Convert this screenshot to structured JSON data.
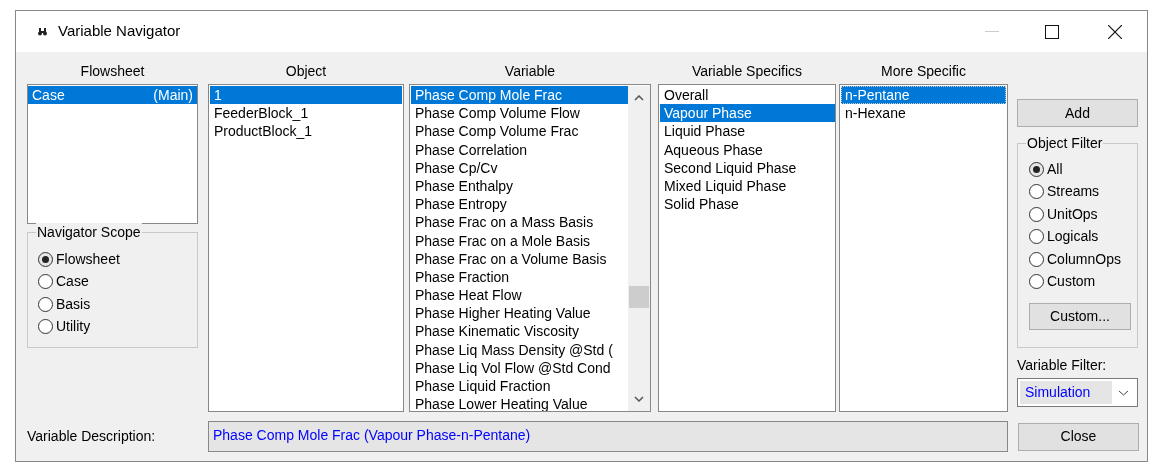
{
  "window": {
    "title": "Variable Navigator"
  },
  "flowsheet": {
    "header": "Flowsheet",
    "items": [
      {
        "label": "Case",
        "tag": "(Main)",
        "selected": true
      }
    ]
  },
  "navigator_scope": {
    "title": "Navigator Scope",
    "options": [
      {
        "label": "Flowsheet",
        "selected": true
      },
      {
        "label": "Case",
        "selected": false
      },
      {
        "label": "Basis",
        "selected": false
      },
      {
        "label": "Utility",
        "selected": false
      }
    ]
  },
  "object": {
    "header": "Object",
    "items": [
      {
        "label": "1",
        "selected": true
      },
      {
        "label": "FeederBlock_1",
        "selected": false
      },
      {
        "label": "ProductBlock_1",
        "selected": false
      }
    ]
  },
  "variable": {
    "header": "Variable",
    "items": [
      {
        "label": "Phase Comp Mole Frac",
        "selected": true
      },
      {
        "label": "Phase Comp Volume Flow",
        "selected": false
      },
      {
        "label": "Phase Comp Volume Frac",
        "selected": false
      },
      {
        "label": "Phase Correlation",
        "selected": false
      },
      {
        "label": "Phase Cp/Cv",
        "selected": false
      },
      {
        "label": "Phase Enthalpy",
        "selected": false
      },
      {
        "label": "Phase Entropy",
        "selected": false
      },
      {
        "label": "Phase Frac on a Mass Basis",
        "selected": false
      },
      {
        "label": "Phase Frac on a Mole Basis",
        "selected": false
      },
      {
        "label": "Phase Frac on a Volume Basis",
        "selected": false
      },
      {
        "label": "Phase Fraction",
        "selected": false
      },
      {
        "label": "Phase Heat Flow",
        "selected": false
      },
      {
        "label": "Phase Higher Heating Value",
        "selected": false
      },
      {
        "label": "Phase Kinematic Viscosity",
        "selected": false
      },
      {
        "label": "Phase Liq Mass Density @Std (",
        "selected": false
      },
      {
        "label": "Phase Liq Vol Flow @Std Cond",
        "selected": false
      },
      {
        "label": "Phase Liquid Fraction",
        "selected": false
      },
      {
        "label": "Phase Lower Heating Value",
        "selected": false
      }
    ]
  },
  "variable_specifics": {
    "header": "Variable Specifics",
    "items": [
      {
        "label": "Overall",
        "selected": false
      },
      {
        "label": "Vapour Phase",
        "selected": true
      },
      {
        "label": "Liquid Phase",
        "selected": false
      },
      {
        "label": "Aqueous Phase",
        "selected": false
      },
      {
        "label": "Second Liquid Phase",
        "selected": false
      },
      {
        "label": "Mixed Liquid Phase",
        "selected": false
      },
      {
        "label": "Solid Phase",
        "selected": false
      }
    ]
  },
  "more_specific": {
    "header": "More Specific",
    "items": [
      {
        "label": "n-Pentane",
        "selected": true
      },
      {
        "label": "n-Hexane",
        "selected": false
      }
    ]
  },
  "add_button": "Add",
  "object_filter": {
    "title": "Object Filter",
    "options": [
      {
        "label": "All",
        "selected": true
      },
      {
        "label": "Streams",
        "selected": false
      },
      {
        "label": "UnitOps",
        "selected": false
      },
      {
        "label": "Logicals",
        "selected": false
      },
      {
        "label": "ColumnOps",
        "selected": false
      },
      {
        "label": "Custom",
        "selected": false
      }
    ],
    "custom_button": "Custom..."
  },
  "variable_filter": {
    "label": "Variable Filter:",
    "value": "Simulation"
  },
  "variable_description": {
    "label": "Variable Description:",
    "value": "Phase Comp Mole Frac (Vapour Phase-n-Pentane)"
  },
  "close_button": "Close"
}
